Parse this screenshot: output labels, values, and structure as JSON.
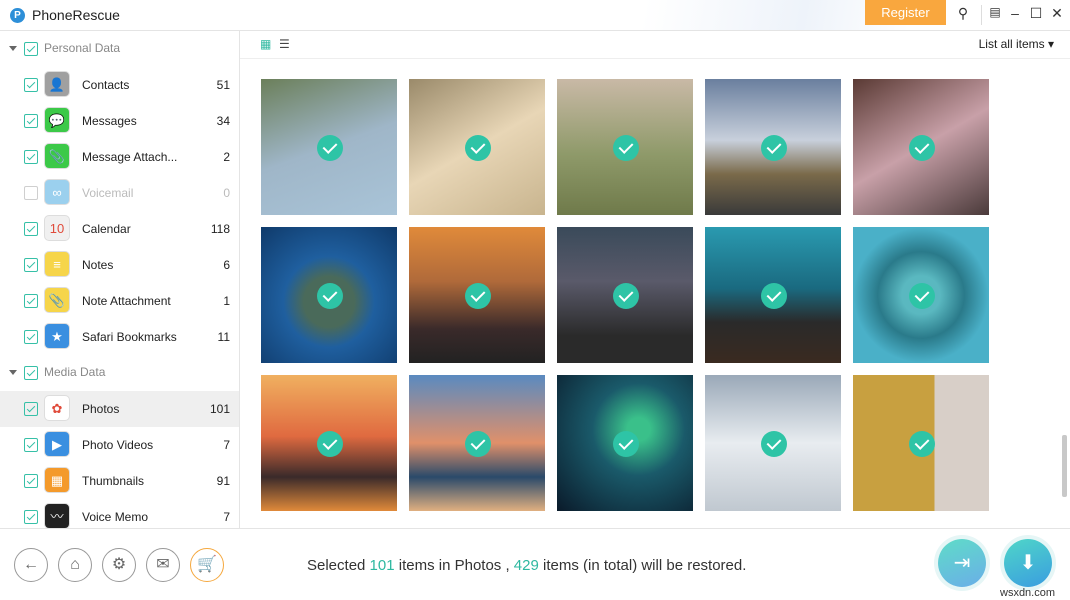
{
  "app": {
    "title": "PhoneRescue",
    "register": "Register"
  },
  "toolbar": {
    "list_filter": "List all items"
  },
  "sidebar": {
    "groups": [
      {
        "name": "Personal Data",
        "items": [
          {
            "label": "Contacts",
            "count": "51",
            "checked": true,
            "color": "#a0a0a0",
            "icon": "contacts-icon",
            "glyph": "👤"
          },
          {
            "label": "Messages",
            "count": "34",
            "checked": true,
            "color": "#3cc948",
            "icon": "messages-icon",
            "glyph": "💬"
          },
          {
            "label": "Message Attach...",
            "count": "2",
            "checked": true,
            "color": "#3cc948",
            "icon": "message-attachment-icon",
            "glyph": "📎"
          },
          {
            "label": "Voicemail",
            "count": "0",
            "checked": false,
            "color": "#9bd0ee",
            "icon": "voicemail-icon",
            "glyph": "∞"
          },
          {
            "label": "Calendar",
            "count": "118",
            "checked": true,
            "color": "#f0f0f0",
            "icon": "calendar-icon",
            "glyph": "10"
          },
          {
            "label": "Notes",
            "count": "6",
            "checked": true,
            "color": "#f6d54a",
            "icon": "notes-icon",
            "glyph": "≡"
          },
          {
            "label": "Note Attachment",
            "count": "1",
            "checked": true,
            "color": "#f6d54a",
            "icon": "note-attachment-icon",
            "glyph": "📎"
          },
          {
            "label": "Safari Bookmarks",
            "count": "11",
            "checked": true,
            "color": "#3a8fe0",
            "icon": "safari-bookmarks-icon",
            "glyph": "★"
          }
        ]
      },
      {
        "name": "Media Data",
        "items": [
          {
            "label": "Photos",
            "count": "101",
            "checked": true,
            "color": "#ffffff",
            "icon": "photos-icon",
            "glyph": "✿",
            "selected": true
          },
          {
            "label": "Photo Videos",
            "count": "7",
            "checked": true,
            "color": "#3a8fe0",
            "icon": "photo-videos-icon",
            "glyph": "▶"
          },
          {
            "label": "Thumbnails",
            "count": "91",
            "checked": true,
            "color": "#f49a2b",
            "icon": "thumbnails-icon",
            "glyph": "▦"
          },
          {
            "label": "Voice Memo",
            "count": "7",
            "checked": true,
            "color": "#222222",
            "icon": "voice-memo-icon",
            "glyph": "〰"
          }
        ]
      }
    ]
  },
  "photos": [
    "linear-gradient(160deg,#6b7f5a,#9fb6c8 50%,#a9c4d8)",
    "linear-gradient(150deg,#9a8a6a,#e8d6b6 50%,#c8b48e)",
    "linear-gradient(180deg,#c9b9a6,#8f9a6a 55%,#6f7a4a)",
    "linear-gradient(180deg,#6a7f9e,#c8d0dc 45%,#7a6a4a 70%,#3a3a3a)",
    "linear-gradient(150deg,#5a3a34,#c8a0a8 50%,#4a3a3a)",
    "radial-gradient(circle at 50% 55%,#4a6a5a 25%,#1f5f9f 45%,#0f3a6a)",
    "linear-gradient(180deg,#e08a3a,#b06a3a 40%,#3a2a2a 75%,#222)",
    "linear-gradient(180deg,#3a4a5a,#5a5a6a 40%,#2a2a2a 80%)",
    "linear-gradient(180deg,#2a9ab0,#1a6a80 45%,#2a2a2a 70%,#3a2a20)",
    "radial-gradient(ellipse at 50% 50%,#5ab8c0 20%,#2a7a8a 45%,#4ab0c8 70%)",
    "linear-gradient(180deg,#f0b060,#e06a40 45%,#3a2a2a 75%,#e08a3a)",
    "linear-gradient(180deg,#5a8ac0,#e0906a 50%,#2a4a6a 75%,#e0b080)",
    "radial-gradient(ellipse at 60% 40%,#3ac08a 10%,#1a5a6a 40%,#0a1a2a)",
    "linear-gradient(180deg,#9aa8b8,#e8ecf0 50%,#c0c8d0)",
    "linear-gradient(90deg,#c8a040 60%,#d8cfc8 60%)"
  ],
  "status": {
    "prefix": "Selected ",
    "selected": "101",
    "middle": " items in Photos , ",
    "total": "429",
    "suffix": " items (in total) will be restored."
  },
  "watermark": "wsxdn.com"
}
